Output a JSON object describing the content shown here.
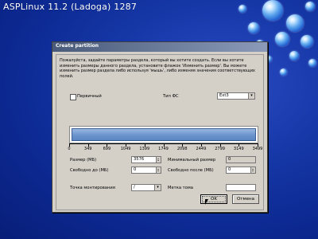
{
  "os": {
    "title": "ASPLinux 11.2 (Ladoga) 1287"
  },
  "dialog": {
    "title": "Create partition",
    "instructions": "Пожалуйста, задайте параметры раздела, который вы хотите создать. Если вы хотите изменить размеры данного раздела, установите флажок 'Изменить размер'. Вы можете изменить размер раздела либо используя 'мышь', либо изменяя значения соответствующих полей.",
    "primary_label": "Первичный",
    "fs_type_label": "Тип ФС",
    "fs_type_value": "Ext3",
    "ruler_ticks": [
      "0",
      "349",
      "699",
      "1049",
      "1399",
      "1749",
      "2098",
      "2449",
      "2799",
      "3149",
      "3499"
    ],
    "size_label": "Размер (МБ)",
    "size_value": "3576",
    "free_before_label": "Свободно до (МБ)",
    "free_before_value": "0",
    "min_size_label": "Минимальный размер",
    "min_size_value": "0",
    "free_after_label": "Свободно после (МБ)",
    "free_after_value": "0",
    "mount_label": "Точка монтирования",
    "mount_value": "/",
    "volume_label_label": "Метка тома",
    "volume_label_value": "",
    "ok_label": "OK",
    "cancel_label": "Отмена"
  }
}
